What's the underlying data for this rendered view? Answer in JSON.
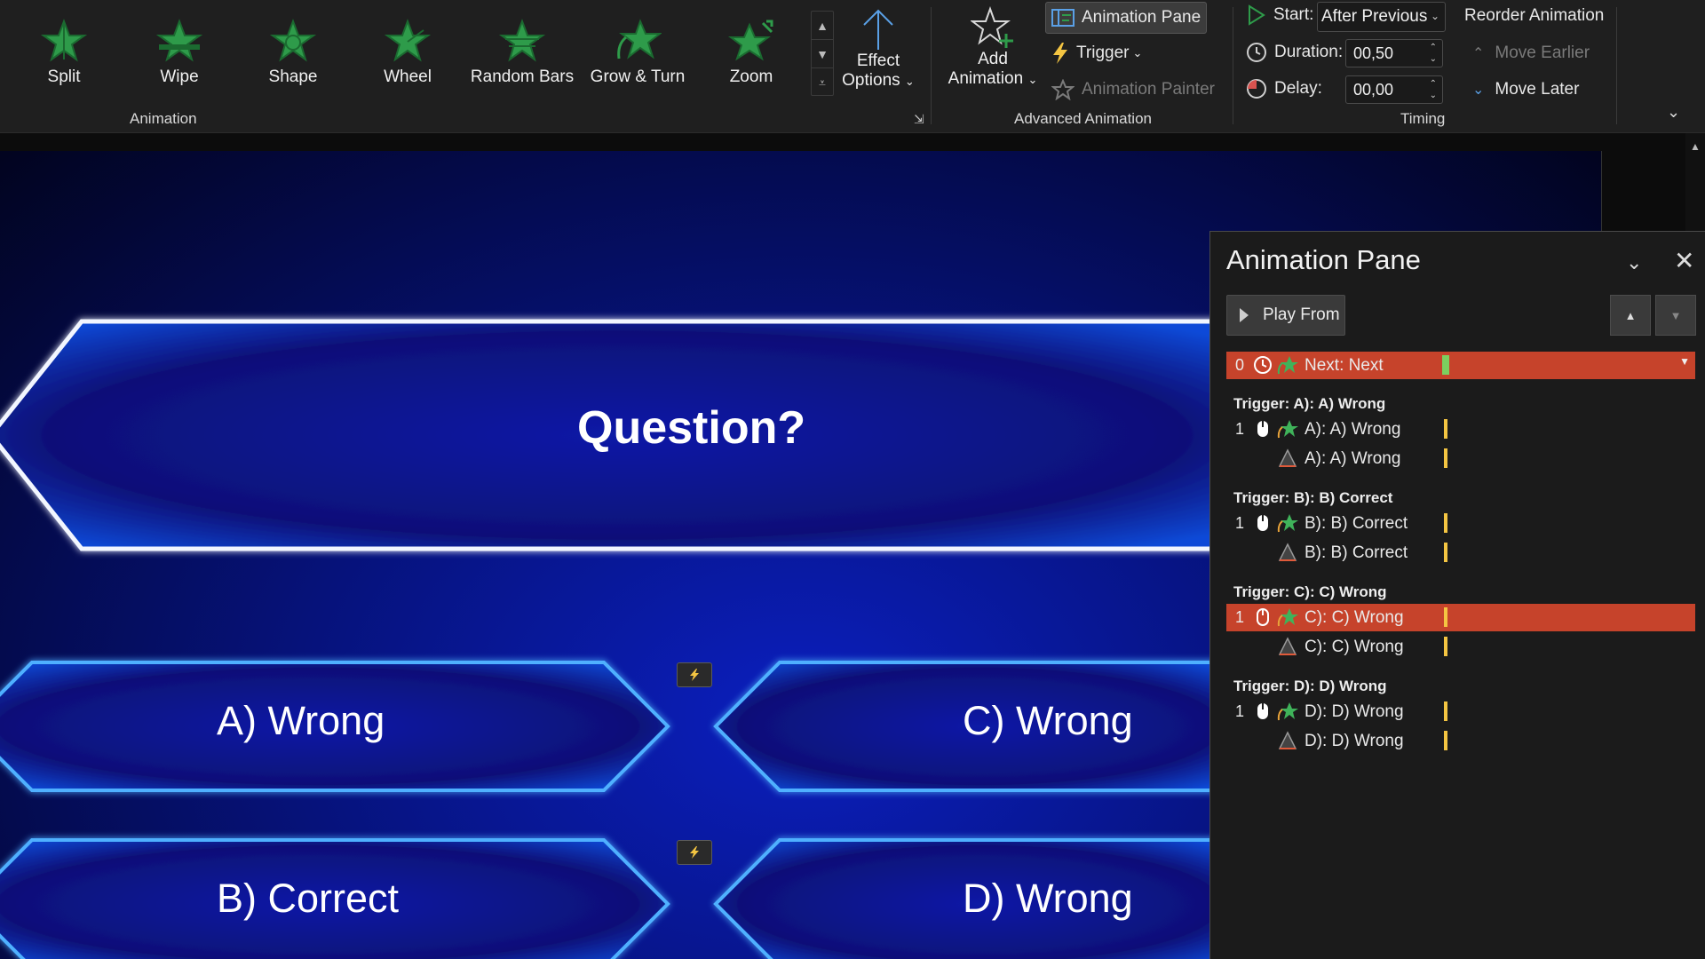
{
  "ribbon": {
    "gallery": [
      {
        "label": "Split",
        "icon": "split-star-icon"
      },
      {
        "label": "Wipe",
        "icon": "wipe-star-icon"
      },
      {
        "label": "Shape",
        "icon": "shape-star-icon"
      },
      {
        "label": "Wheel",
        "icon": "wheel-star-icon"
      },
      {
        "label": "Random Bars",
        "icon": "random-bars-star-icon"
      },
      {
        "label": "Grow & Turn",
        "icon": "grow-turn-star-icon"
      },
      {
        "label": "Zoom",
        "icon": "zoom-star-icon"
      }
    ],
    "effect_options": {
      "line1": "Effect",
      "line2": "Options"
    },
    "animation_group_label": "Animation",
    "add_animation": {
      "line1": "Add",
      "line2": "Animation"
    },
    "animation_pane_label": "Animation Pane",
    "trigger_label": "Trigger",
    "animation_painter_label": "Animation Painter",
    "advanced_group_label": "Advanced Animation",
    "start_label": "Start:",
    "start_value": "After Previous",
    "duration_label": "Duration:",
    "duration_value": "00,50",
    "delay_label": "Delay:",
    "delay_value": "00,00",
    "timing_group_label": "Timing",
    "reorder_label": "Reorder Animation",
    "move_earlier_label": "Move Earlier",
    "move_later_label": "Move Later",
    "accent_green": "#2e9b4a"
  },
  "slide": {
    "question": "Question?",
    "answers": {
      "a": "A) Wrong",
      "b": "B) Correct",
      "c": "C) Wrong",
      "d": "D) Wrong"
    }
  },
  "pane": {
    "title": "Animation Pane",
    "play_from": "Play From",
    "rows": {
      "next": {
        "num": "0",
        "text": "Next: Next"
      },
      "a_header": "Trigger: A): A) Wrong",
      "a1": {
        "num": "1",
        "text": "A): A) Wrong"
      },
      "a2": {
        "text": "A): A) Wrong"
      },
      "b_header": "Trigger: B): B) Correct",
      "b1": {
        "num": "1",
        "text": "B): B) Correct"
      },
      "b2": {
        "text": "B): B) Correct"
      },
      "c_header": "Trigger: C): C) Wrong",
      "c1": {
        "num": "1",
        "text": "C): C) Wrong"
      },
      "c2": {
        "text": "C): C) Wrong"
      },
      "d_header": "Trigger: D): D) Wrong",
      "d1": {
        "num": "1",
        "text": "D): D) Wrong"
      },
      "d2": {
        "text": "D): D) Wrong"
      }
    },
    "selected_color": "#c6432b",
    "timeline_color": "#f4c542"
  }
}
